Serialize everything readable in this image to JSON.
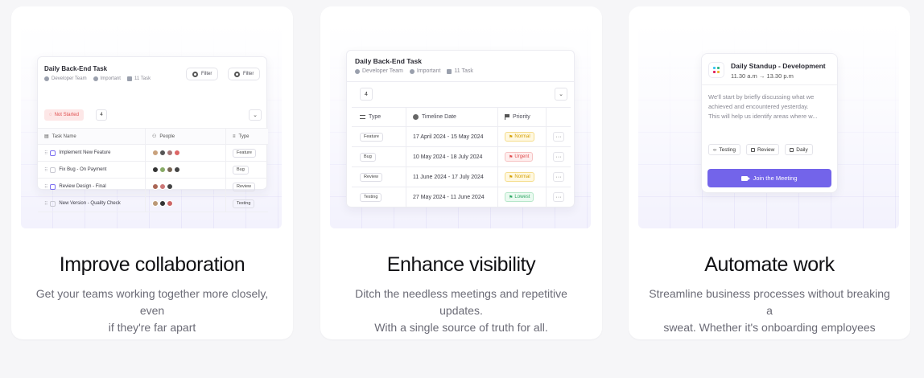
{
  "cards": [
    {
      "title": "Improve collaboration",
      "desc_line1": "Get your teams working together more closely, even",
      "desc_line2": "if they're far apart",
      "mock": {
        "task_title": "Daily Back-End Task",
        "meta": [
          "Developer Team",
          "Important",
          "11 Task"
        ],
        "filter_labels": [
          "Filter",
          "Filter"
        ],
        "status_badge": "Not Started",
        "count": "4",
        "columns": [
          "Task Name",
          "People",
          "Type"
        ],
        "rows": [
          {
            "name": "Implement New Feature",
            "checked": true,
            "type": "Feature"
          },
          {
            "name": "Fix Bug - On Payment",
            "checked": false,
            "type": "Bug"
          },
          {
            "name": "Review Design - Final",
            "checked": true,
            "type": "Review"
          },
          {
            "name": "New Version - Quality Check",
            "checked": false,
            "type": "Testing"
          }
        ]
      }
    },
    {
      "title": "Enhance visibility",
      "desc_line1": "Ditch the needless meetings and repetitive updates.",
      "desc_line2": "With a single source of truth for all.",
      "mock": {
        "task_title": "Daily Back-End Task",
        "meta": [
          "Developer Team",
          "Important",
          "11 Task"
        ],
        "count": "4",
        "columns": [
          "Type",
          "Timeline Date",
          "Priority"
        ],
        "rows": [
          {
            "type": "Feature",
            "date": "17 April 2024 - 15 May 2024",
            "priority": "Normal",
            "level": "normal"
          },
          {
            "type": "Bug",
            "date": "10 May 2024 - 18 July 2024",
            "priority": "Urgent",
            "level": "urgent"
          },
          {
            "type": "Review",
            "date": "11 June 2024 - 17 July 2024",
            "priority": "Normal",
            "level": "normal"
          },
          {
            "type": "Testing",
            "date": "27 May 2024 - 11 June 2024",
            "priority": "Lowest",
            "level": "lowest"
          }
        ],
        "more_label": "···"
      }
    },
    {
      "title": "Automate work",
      "desc_line1": "Streamline business processes without breaking a",
      "desc_line2": "sweat. Whether it's onboarding employees",
      "mock": {
        "event_title": "Daily Standup - Development",
        "event_time": "11.30 a.m → 13.30 p.m",
        "body_lines": [
          "We'll start by briefly discussing what we",
          "achieved and encountered yesterday.",
          "This will help us identify areas where w..."
        ],
        "tags": [
          "Testing",
          "Review",
          "Daily"
        ],
        "join_label": "Join the Meeting"
      }
    }
  ],
  "colors": {
    "accent": "#7364ea",
    "normal": "#d4a106",
    "urgent": "#e04e4e",
    "lowest": "#2fa864",
    "not_started": "#e05050"
  }
}
